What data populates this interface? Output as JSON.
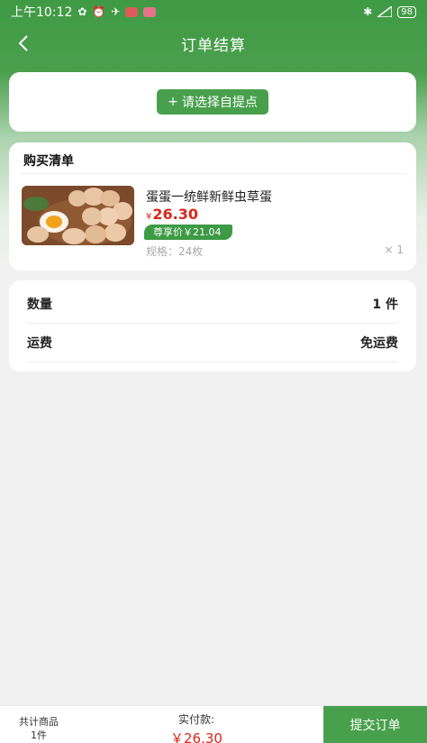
{
  "status_bar": {
    "time": "上午10:12",
    "battery": "98"
  },
  "nav": {
    "title": "订单结算"
  },
  "pickup": {
    "button_label": "请选择自提点"
  },
  "purchase_list": {
    "title": "购买清单",
    "items": [
      {
        "name": "蛋蛋一统鲜新鲜虫草蛋",
        "price_symbol": "¥",
        "price": "26.30",
        "vip_label": "尊享价￥21.04",
        "spec": "规格：24枚",
        "quantity": "× 1"
      }
    ]
  },
  "summary": {
    "rows": [
      {
        "label": "数量",
        "value": "1 件"
      },
      {
        "label": "运费",
        "value": "免运费"
      }
    ]
  },
  "bottom_bar": {
    "total_items_label": "共计商品",
    "total_items_count": "1件",
    "pay_label": "实付款:",
    "pay_amount": "￥26.30",
    "submit_label": "提交订单"
  },
  "colors": {
    "primary_green": "#48a04d",
    "price_red": "#d9261c"
  }
}
